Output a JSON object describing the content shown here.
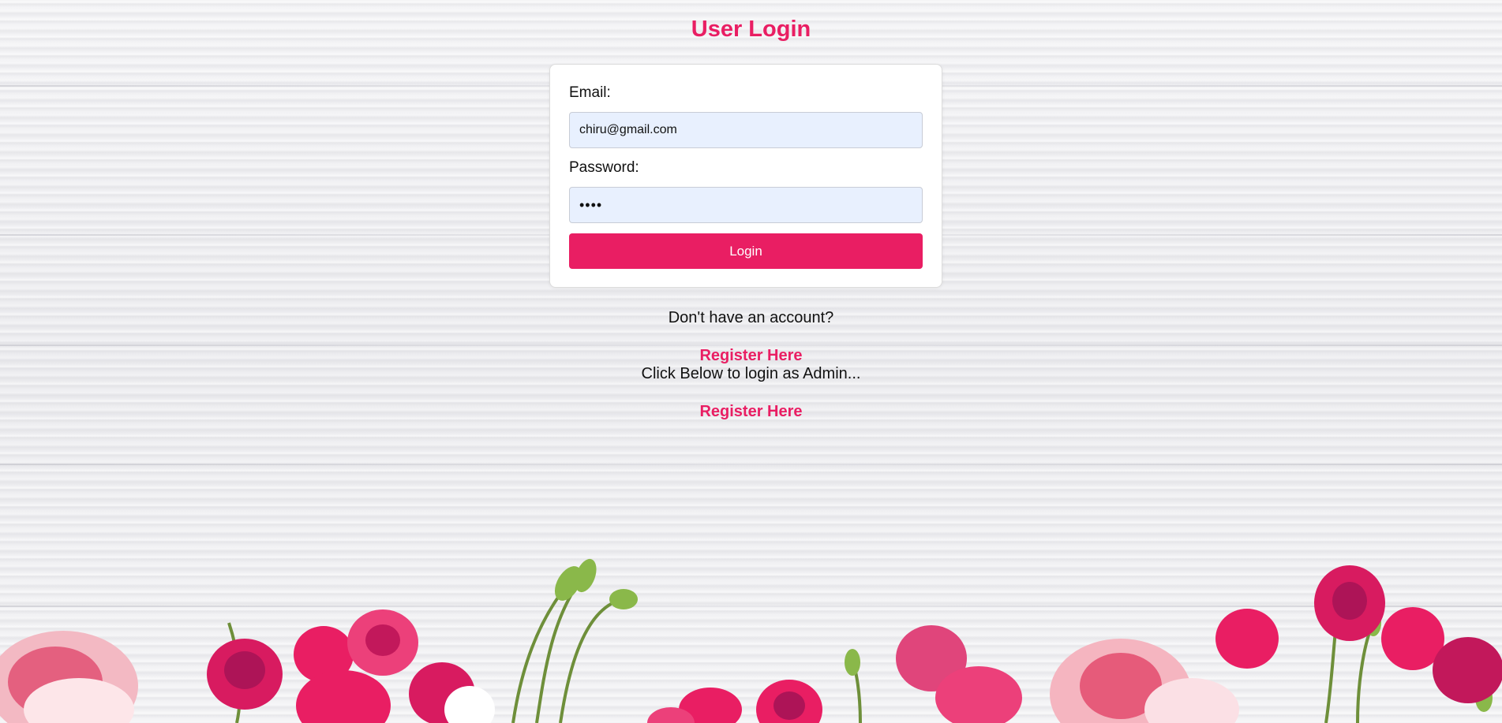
{
  "page": {
    "title": "User Login"
  },
  "form": {
    "email_label": "Email:",
    "email_value": "chiru@gmail.com",
    "password_label": "Password:",
    "password_value": "••••",
    "login_label": "Login"
  },
  "footer": {
    "no_account_text": "Don't have an account?",
    "register_link": "Register Here",
    "admin_text": "Click Below to login as Admin...",
    "admin_link": "Register Here"
  },
  "colors": {
    "accent": "#e91e63",
    "input_bg": "#e8f0fe",
    "card_bg": "#ffffff"
  },
  "decor": {
    "background": "white-wood-planks",
    "border_art": "pink-roses"
  }
}
